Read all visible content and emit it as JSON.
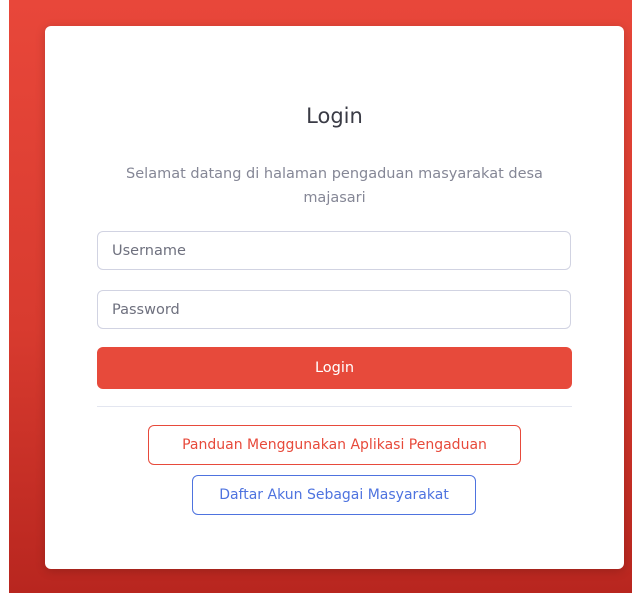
{
  "page": {
    "title": "Login",
    "subtitle": "Selamat datang di halaman pengaduan masyarakat desa majasari"
  },
  "form": {
    "username_placeholder": "Username",
    "username_value": "",
    "password_placeholder": "Password",
    "password_value": "",
    "login_label": "Login"
  },
  "links": {
    "guide_label": "Panduan Menggunakan Aplikasi Pengaduan",
    "register_label": "Daftar Akun Sebagai Masyarakat"
  },
  "colors": {
    "background_gradient": [
      "#e8473a",
      "#b8261f"
    ],
    "primary_danger": "#e74a3b",
    "primary_blue": "#4e73df",
    "text_muted": "#858796"
  }
}
